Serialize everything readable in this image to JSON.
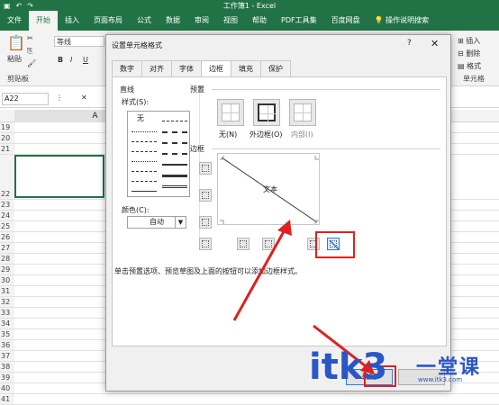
{
  "excel": {
    "window_title": "工作簿1 - Excel",
    "tabs": [
      "文件",
      "开始",
      "插入",
      "页面布局",
      "公式",
      "数据",
      "审阅",
      "视图",
      "帮助",
      "PDF工具集",
      "百度网盘",
      "操作说明搜索"
    ],
    "ribbon": {
      "paste_label": "粘贴",
      "clipboard_label": "剪贴板",
      "font_name": "等线",
      "bold": "B",
      "italic": "I",
      "underline": "U",
      "insert_label": "插入",
      "delete_label": "删除",
      "format_label": "格式",
      "cells_label": "单元格"
    },
    "name_box": "A22",
    "column_header": "A",
    "row_numbers": [
      "19",
      "20",
      "21",
      "22",
      "23",
      "24",
      "25",
      "26",
      "27",
      "28",
      "29",
      "30",
      "31",
      "32",
      "33",
      "34",
      "35",
      "36",
      "37",
      "38",
      "39",
      "40",
      "41"
    ]
  },
  "dialog": {
    "title": "设置单元格格式",
    "help": "?",
    "close": "✕",
    "tabs": [
      "数字",
      "对齐",
      "字体",
      "边框",
      "填充",
      "保护"
    ],
    "active_tab": "边框",
    "line_section": "直线",
    "style_label": "样式(S):",
    "style_none": "无",
    "color_label": "颜色(C):",
    "color_value": "自动",
    "preset_section": "预置",
    "presets": [
      "无(N)",
      "外边框(O)",
      "内部(I)"
    ],
    "border_section": "边框",
    "preview_text": "文本",
    "hint": "单击预置选项、预览草图及上面的按钮可以添加边框样式。",
    "ok_label": "确定"
  },
  "watermark": {
    "logo": "itk3",
    "cn": "一堂课",
    "url": "www.itk3.com"
  },
  "colors": {
    "excel_green": "#217346",
    "annotation_red": "#e02020",
    "watermark_blue": "#2a56c6"
  }
}
